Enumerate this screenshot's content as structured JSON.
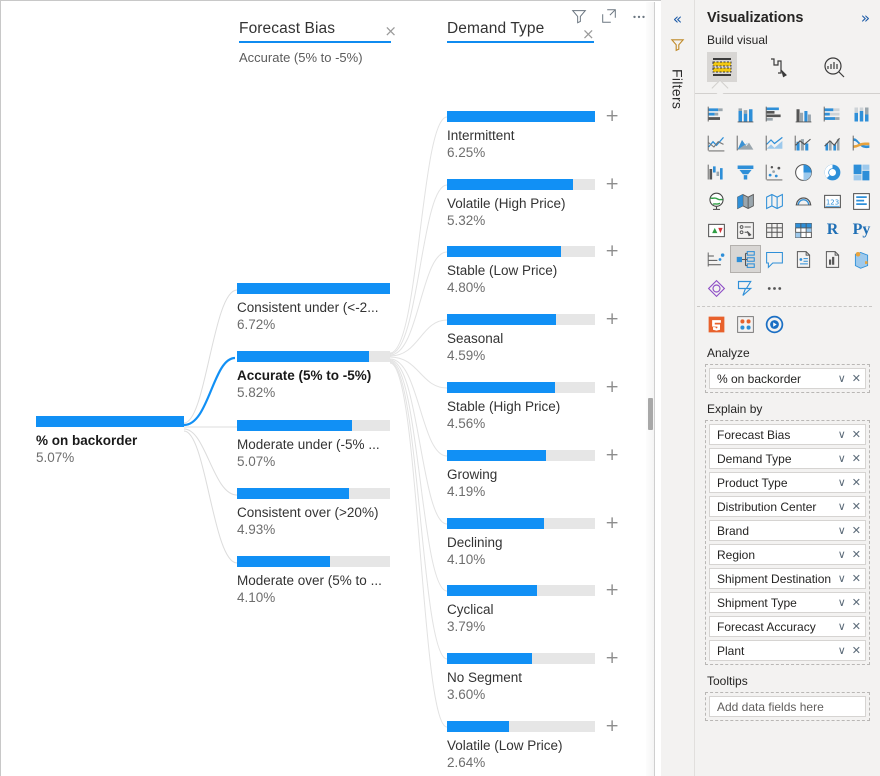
{
  "visual": {
    "header_icons": [
      {
        "name": "filter-icon",
        "title": "Filters"
      },
      {
        "name": "focus-mode-icon",
        "title": "Focus mode"
      },
      {
        "name": "more-options-icon",
        "title": "More options"
      }
    ],
    "columns": [
      {
        "title": "Forecast Bias",
        "subtitle": "Accurate (5% to -5%)",
        "close_label": "×"
      },
      {
        "title": "Demand Type",
        "subtitle": "",
        "close_label": "×"
      }
    ],
    "root": {
      "label": "% on backorder",
      "value": "5.07%",
      "fill_ratio": 1.0
    },
    "level1": [
      {
        "label": "Consistent under (<-2...",
        "value": "6.72%",
        "fill_ratio": 1.0,
        "selected": false
      },
      {
        "label": "Accurate (5% to -5%)",
        "value": "5.82%",
        "fill_ratio": 0.866,
        "selected": true
      },
      {
        "label": "Moderate under (-5% ...",
        "value": "5.07%",
        "fill_ratio": 0.754,
        "selected": false
      },
      {
        "label": "Consistent over (>20%)",
        "value": "4.93%",
        "fill_ratio": 0.734,
        "selected": false
      },
      {
        "label": "Moderate over (5% to ...",
        "value": "4.10%",
        "fill_ratio": 0.61,
        "selected": false
      }
    ],
    "level2": [
      {
        "label": "Intermittent",
        "value": "6.25%",
        "fill_ratio": 1.0,
        "expand": "+"
      },
      {
        "label": "Volatile (High Price)",
        "value": "5.32%",
        "fill_ratio": 0.851,
        "expand": "+"
      },
      {
        "label": "Stable (Low Price)",
        "value": "4.80%",
        "fill_ratio": 0.768,
        "expand": "+"
      },
      {
        "label": "Seasonal",
        "value": "4.59%",
        "fill_ratio": 0.734,
        "expand": "+"
      },
      {
        "label": "Stable (High Price)",
        "value": "4.56%",
        "fill_ratio": 0.73,
        "expand": "+"
      },
      {
        "label": "Growing",
        "value": "4.19%",
        "fill_ratio": 0.67,
        "expand": "+"
      },
      {
        "label": "Declining",
        "value": "4.10%",
        "fill_ratio": 0.656,
        "expand": "+"
      },
      {
        "label": "Cyclical",
        "value": "3.79%",
        "fill_ratio": 0.606,
        "expand": "+"
      },
      {
        "label": "No Segment",
        "value": "3.60%",
        "fill_ratio": 0.576,
        "expand": "+"
      },
      {
        "label": "Volatile (Low Price)",
        "value": "2.64%",
        "fill_ratio": 0.422,
        "expand": "+"
      }
    ],
    "accent_color": "#1190f5",
    "track_color": "#e6e6e6"
  },
  "filters_rail": {
    "collapse_label": "«",
    "filter_icon": "filter-icon",
    "label": "Filters"
  },
  "visualizations": {
    "title": "Visualizations",
    "expand_label": "»",
    "build_visual_label": "Build visual",
    "modes": [
      {
        "name": "build-visual-mode",
        "selected": true
      },
      {
        "name": "format-visual-mode",
        "selected": false
      },
      {
        "name": "analytics-mode",
        "selected": false
      }
    ],
    "icons": [
      "stacked-bar-chart-icon",
      "stacked-column-chart-icon",
      "clustered-bar-chart-icon",
      "clustered-column-chart-icon",
      "hundred-percent-stacked-bar-chart-icon",
      "hundred-percent-stacked-column-chart-icon",
      "line-chart-icon",
      "area-chart-icon",
      "stacked-area-chart-icon",
      "line-and-stacked-column-chart-icon",
      "line-and-clustered-column-chart-icon",
      "ribbon-chart-icon",
      "waterfall-chart-icon",
      "funnel-chart-icon",
      "scatter-chart-icon",
      "pie-chart-icon",
      "donut-chart-icon",
      "treemap-icon",
      "map-icon",
      "filled-map-icon",
      "shape-map-icon",
      "azure-map-icon",
      "card-icon",
      "multi-row-card-icon",
      "kpi-icon",
      "slicer-icon",
      "table-icon",
      "matrix-icon",
      "r-script-visual-icon",
      "python-visual-icon",
      "key-influencers-icon",
      "decomposition-tree-icon",
      "qa-visual-icon",
      "narrative-icon",
      "paginated-report-icon",
      "arcgis-maps-icon",
      "power-apps-icon",
      "power-automate-icon",
      "more-visuals-icon"
    ],
    "selected_icon": "decomposition-tree-icon",
    "store_icons": [
      "html-content-icon",
      "sandbox-visual-icon",
      "play-axis-icon"
    ],
    "analyze": {
      "label": "Analyze",
      "fields": [
        {
          "name": "% on backorder",
          "caret": "∨",
          "remove": "✕"
        }
      ]
    },
    "explain_by": {
      "label": "Explain by",
      "fields": [
        {
          "name": "Forecast Bias",
          "caret": "∨",
          "remove": "✕"
        },
        {
          "name": "Demand Type",
          "caret": "∨",
          "remove": "✕"
        },
        {
          "name": "Product Type",
          "caret": "∨",
          "remove": "✕"
        },
        {
          "name": "Distribution Center",
          "caret": "∨",
          "remove": "✕"
        },
        {
          "name": "Brand",
          "caret": "∨",
          "remove": "✕"
        },
        {
          "name": "Region",
          "caret": "∨",
          "remove": "✕"
        },
        {
          "name": "Shipment Destination",
          "caret": "∨",
          "remove": "✕"
        },
        {
          "name": "Shipment Type",
          "caret": "∨",
          "remove": "✕"
        },
        {
          "name": "Forecast Accuracy",
          "caret": "∨",
          "remove": "✕"
        },
        {
          "name": "Plant",
          "caret": "∨",
          "remove": "✕"
        }
      ]
    },
    "tooltips": {
      "label": "Tooltips",
      "placeholder": "Add data fields here"
    }
  }
}
